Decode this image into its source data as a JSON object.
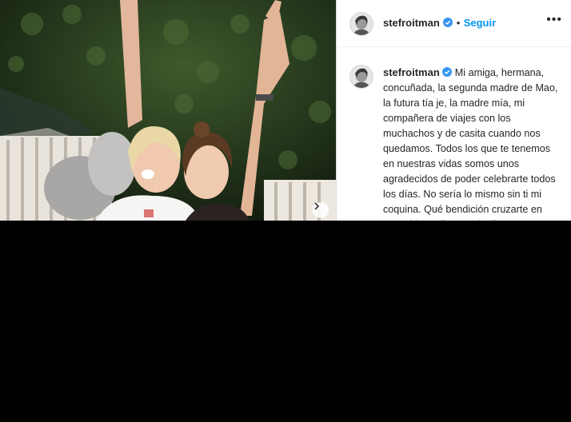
{
  "post": {
    "username": "stefroitman",
    "follow_label": "Seguir",
    "separator": "•",
    "more_label": "•••",
    "caption": "Mi amiga, hermana, concuñada, la segunda madre de Mao, la futura tía je, la madre mía, mi compañera de viajes con los muchachos y de casita cuando nos quedamos. Todos los que te tenemos en nuestras vidas somos unos agradecidos de poder celebrarte todos los días. No sería lo mismo sin ti mi coquina. Qué bendición cruzarte en esta vida. Feliz cumpleaños cucurrrrraaaaa. Te amo!!!"
  },
  "icons": {
    "verified": "verified-badge-icon",
    "next": "chevron-right-icon",
    "more": "more-options-icon"
  },
  "colors": {
    "accent": "#0095f6",
    "text": "#262626",
    "border": "#dbdbdb",
    "below_background": "#000000"
  }
}
